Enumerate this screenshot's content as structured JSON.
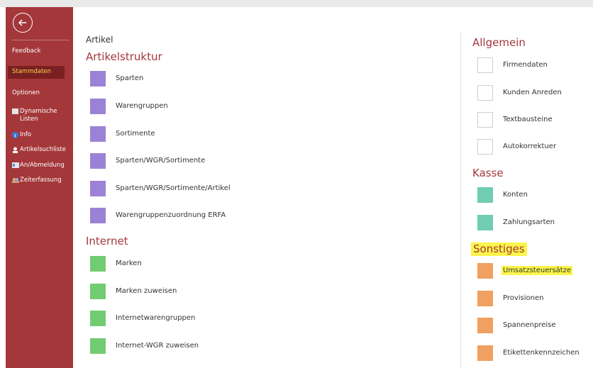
{
  "sidebar": {
    "items": [
      {
        "label": "Feedback"
      },
      {
        "label": "Stammdaten"
      },
      {
        "label": "Optionen"
      },
      {
        "label": "Dynamische Listen"
      },
      {
        "label": "Info"
      },
      {
        "label": "Artikelsuchliste"
      },
      {
        "label": "An/Abmeldung"
      },
      {
        "label": "Zeiterfassung"
      }
    ]
  },
  "main": {
    "section_title": "Artikel",
    "left": {
      "artikelstruktur": {
        "heading": "Artikelstruktur",
        "items": [
          "Sparten",
          "Warengruppen",
          "Sortimente",
          "Sparten/WGR/Sortimente",
          "Sparten/WGR/Sortimente/Artikel",
          "Warengruppenzuordnung ERFA"
        ]
      },
      "internet": {
        "heading": "Internet",
        "items": [
          "Marken",
          "Marken zuweisen",
          "Internetwarengruppen",
          "Internet-WGR zuweisen"
        ]
      }
    },
    "right": {
      "allgemein": {
        "heading": "Allgemein",
        "items": [
          "Firmendaten",
          "Kunden Anreden",
          "Textbausteine",
          "Autokorrektuer"
        ]
      },
      "kasse": {
        "heading": "Kasse",
        "items": [
          "Konten",
          "Zahlungsarten"
        ]
      },
      "sonstiges": {
        "heading": "Sonstiges",
        "items": [
          "Umsatzsteuersätze",
          "Provisionen",
          "Spannenpreise",
          "Etikettenkennzeichen"
        ]
      }
    }
  },
  "colors": {
    "sidebar": "#a4373a",
    "sidebar_selected": "#7a1f22",
    "purple": "#9c82d6",
    "green": "#72cc72",
    "teal": "#6fcdb1",
    "orange": "#f0a060",
    "highlight": "#fbf54a"
  },
  "icons": {
    "back": "arrow-left-icon",
    "list": "list-icon",
    "info": "info-icon",
    "search": "search-person-icon",
    "login": "id-card-icon",
    "time": "people-clock-icon"
  }
}
